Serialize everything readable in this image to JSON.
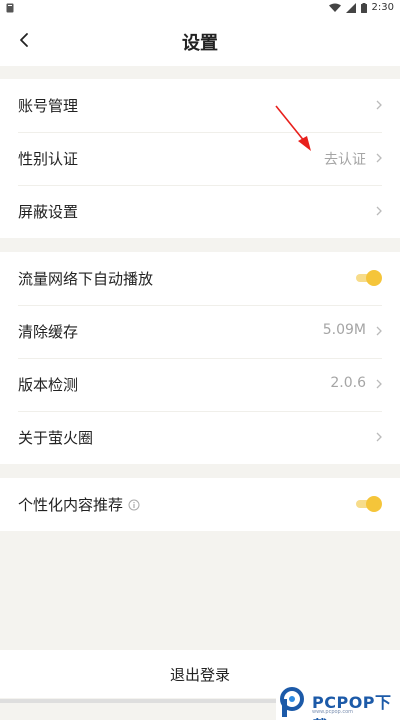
{
  "status_bar": {
    "time": "2:30"
  },
  "header": {
    "title": "设置",
    "back_icon": "chevron-left-icon"
  },
  "group1": {
    "items": [
      {
        "label": "账号管理",
        "value": ""
      },
      {
        "label": "性别认证",
        "value": "去认证"
      },
      {
        "label": "屏蔽设置",
        "value": ""
      }
    ]
  },
  "group2": {
    "autoplay": {
      "label": "流量网络下自动播放",
      "enabled": true
    },
    "items": [
      {
        "label": "清除缓存",
        "value": "5.09M"
      },
      {
        "label": "版本检测",
        "value": "2.0.6"
      },
      {
        "label": "关于萤火圈",
        "value": ""
      }
    ]
  },
  "group3": {
    "personalize": {
      "label": "个性化内容推荐",
      "enabled": true
    }
  },
  "logout": {
    "label": "退出登录"
  },
  "watermark": {
    "brand": "PCPOP下载",
    "sub": "www.pcpop.com"
  },
  "colors": {
    "toggle_on": "#f5c53a",
    "toggle_track": "#f7dc8a",
    "page_bg": "#f4f3ef",
    "annotation_arrow": "#e8201c"
  }
}
